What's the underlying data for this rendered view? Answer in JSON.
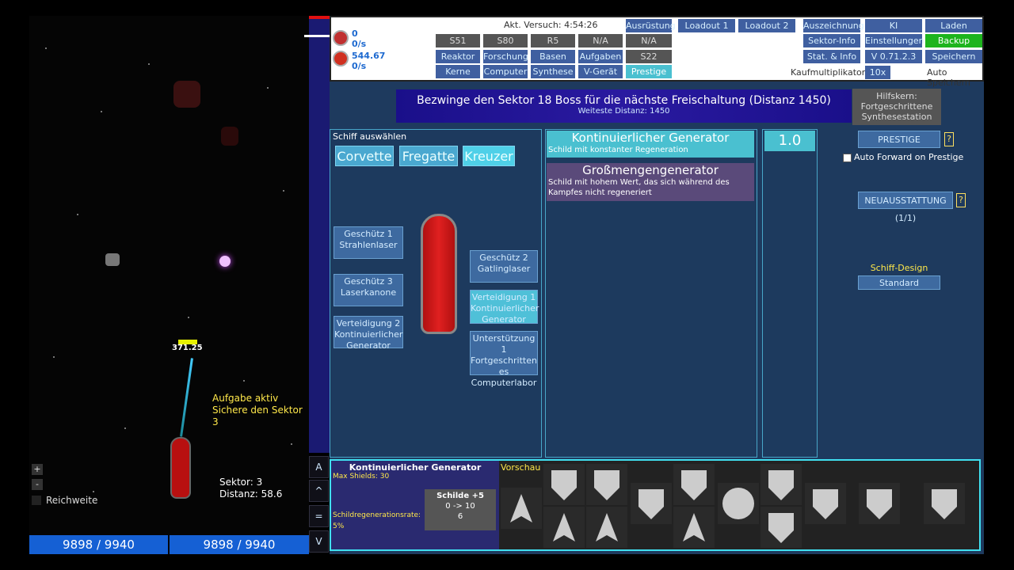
{
  "space": {
    "enemy_hp_value": "371.25",
    "task_title": "Aufgabe aktiv",
    "task_text": "Sichere den Sektor 3",
    "sector_label": "Sektor: 3",
    "distance_label": "Distanz: 58.6",
    "zoom_in": "+",
    "zoom_out": "-",
    "range_label": "Reichweite",
    "hp_left": "9898 / 9940",
    "hp_right": "9898 / 9940"
  },
  "side_buttons": [
    "A",
    "^",
    "=",
    "V"
  ],
  "topbar": {
    "resource1_value": "0",
    "resource1_rate": "0/s",
    "resource2_value": "544.67",
    "resource2_rate": "0/s",
    "attempt_time": "Akt. Versuch: 4:54:26",
    "row1": [
      "S51",
      "S80",
      "R5",
      "N/A",
      "N/A"
    ],
    "row2": [
      "Reaktor",
      "Forschung",
      "Basen",
      "Aufgaben",
      "S22"
    ],
    "row3": [
      "Kerne",
      "Computer",
      "Synthese",
      "V-Gerät",
      "Prestige"
    ],
    "equipment": "Ausrüstung",
    "loadout1": "Loadout 1",
    "loadout2": "Loadout 2",
    "right_col1": [
      "Auszeichnung",
      "Sektor-Info",
      "Stat. & Info"
    ],
    "right_col2": [
      "KI",
      "Einstellungen",
      "V 0.71.2.3"
    ],
    "right_col3": [
      "Laden",
      "Backup",
      "Speichern"
    ],
    "buy_multiplier_label": "Kaufmultiplikator:",
    "buy_multiplier_value": "10x",
    "autosave": "Auto Speichern"
  },
  "banner": {
    "title": "Bezwinge den Sektor 18 Boss für die nächste Freischaltung (Distanz 1450)",
    "subtitle": "Weiteste Distanz: 1450",
    "helper_title": "Hilfskern:",
    "helper_text": "Fortgeschrittene Synthesestation"
  },
  "ship": {
    "select_label": "Schiff auswählen",
    "types": [
      "Corvette",
      "Fregatte",
      "Kreuzer"
    ],
    "slot_gun1": "Geschütz 1 Strahlenlaser",
    "slot_gun3": "Geschütz 3 Laserkanone",
    "slot_def2": "Verteidigung 2 Kontinuierlicher Generator",
    "slot_gun2": "Geschütz 2 Gatlinglaser",
    "slot_def1": "Verteidigung 1 Kontinuierlicher Generator",
    "slot_sup1": "Unterstützung 1 Fortgeschritten es Computerlabor"
  },
  "generators": [
    {
      "title": "Kontinuierlicher Generator",
      "desc": "Schild mit konstanter Regeneration"
    },
    {
      "title": "Großmengengenerator",
      "desc": "Schild mit hohem Wert, das sich während des Kampfes nicht regeneriert"
    }
  ],
  "level_value": "1.0",
  "right_actions": {
    "prestige": "PRESTIGE",
    "auto_forward": "Auto Forward on Prestige",
    "refit": "NEUAUSSTATTUNG (1/1)",
    "design_label": "Schiff-Design",
    "design_value": "Standard",
    "help": "?"
  },
  "bottom": {
    "item_title": "Kontinuierlicher Generator",
    "max_shields": "Max Shields: 30",
    "regen_label": "Schildregenerationsrate:",
    "regen_value": "5%",
    "upgrade_title": "Schilde +5",
    "upgrade_range": "0 -> 10",
    "upgrade_cost": "6",
    "preview": "Vorschau"
  },
  "colors": {
    "accent_cyan": "#40e0f0",
    "panel_blue": "#1e3a5e",
    "button_blue": "#3e6aa0",
    "hp_blue": "#1560d4",
    "backup_green": "#1db41d",
    "banner_purple": "#1a0f8a"
  }
}
